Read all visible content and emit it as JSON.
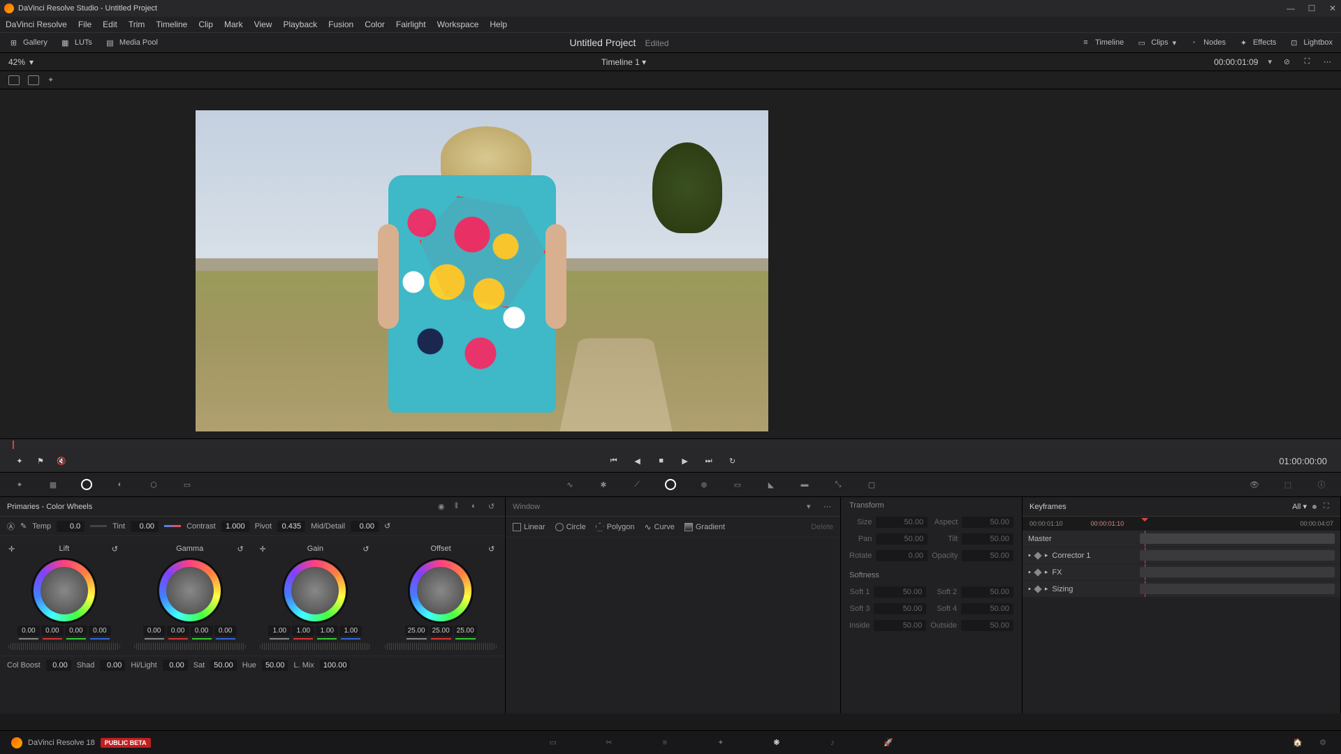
{
  "app": {
    "title": "DaVinci Resolve Studio - Untitled Project",
    "name": "DaVinci Resolve 18",
    "beta": "PUBLIC BETA"
  },
  "menu": [
    "DaVinci Resolve",
    "File",
    "Edit",
    "Trim",
    "Timeline",
    "Clip",
    "Mark",
    "View",
    "Playback",
    "Fusion",
    "Color",
    "Fairlight",
    "Workspace",
    "Help"
  ],
  "toolbar": {
    "gallery": "Gallery",
    "luts": "LUTs",
    "mediapool": "Media Pool",
    "project": "Untitled Project",
    "edited": "Edited",
    "timeline": "Timeline",
    "clips": "Clips",
    "nodes": "Nodes",
    "effects": "Effects",
    "lightbox": "Lightbox"
  },
  "subbar": {
    "zoom": "42%",
    "timeline": "Timeline 1",
    "timecode": "00:00:01:09"
  },
  "transport": {
    "timecode": "01:00:00:00"
  },
  "primaries": {
    "title": "Primaries - Color Wheels",
    "adj": {
      "temp_l": "Temp",
      "temp": "0.0",
      "tint_l": "Tint",
      "tint": "0.00",
      "contrast_l": "Contrast",
      "contrast": "1.000",
      "pivot_l": "Pivot",
      "pivot": "0.435",
      "mid_l": "Mid/Detail",
      "mid": "0.00"
    },
    "wheels": [
      {
        "name": "Lift",
        "vals": [
          "0.00",
          "0.00",
          "0.00",
          "0.00"
        ]
      },
      {
        "name": "Gamma",
        "vals": [
          "0.00",
          "0.00",
          "0.00",
          "0.00"
        ]
      },
      {
        "name": "Gain",
        "vals": [
          "1.00",
          "1.00",
          "1.00",
          "1.00"
        ]
      },
      {
        "name": "Offset",
        "vals": [
          "25.00",
          "25.00",
          "25.00"
        ]
      }
    ],
    "bottom": {
      "colboost_l": "Col Boost",
      "colboost": "0.00",
      "shad_l": "Shad",
      "shad": "0.00",
      "hilight_l": "Hi/Light",
      "hilight": "0.00",
      "sat_l": "Sat",
      "sat": "50.00",
      "hue_l": "Hue",
      "hue": "50.00",
      "lmix_l": "L. Mix",
      "lmix": "100.00"
    }
  },
  "window": {
    "title": "Window",
    "shapes": {
      "linear": "Linear",
      "circle": "Circle",
      "polygon": "Polygon",
      "curve": "Curve",
      "gradient": "Gradient",
      "delete": "Delete"
    }
  },
  "transform": {
    "title": "Transform",
    "params": {
      "size_l": "Size",
      "size": "50.00",
      "aspect_l": "Aspect",
      "aspect": "50.00",
      "pan_l": "Pan",
      "pan": "50.00",
      "tilt_l": "Tilt",
      "tilt": "50.00",
      "rotate_l": "Rotate",
      "rotate": "0.00",
      "opacity_l": "Opacity",
      "opacity": "50.00"
    },
    "softness_title": "Softness",
    "softness": {
      "s1_l": "Soft 1",
      "s1": "50.00",
      "s2_l": "Soft 2",
      "s2": "50.00",
      "s3_l": "Soft 3",
      "s3": "50.00",
      "s4_l": "Soft 4",
      "s4": "50.00",
      "inside_l": "Inside",
      "inside": "50.00",
      "outside_l": "Outside",
      "outside": "50.00"
    }
  },
  "keyframes": {
    "title": "Keyframes",
    "all": "All",
    "ruler": {
      "start": "00:00:01:10",
      "mid": "00:00:01:10",
      "end": "00:00:04:07"
    },
    "tracks": [
      "Master",
      "Corrector 1",
      "FX",
      "Sizing"
    ]
  }
}
